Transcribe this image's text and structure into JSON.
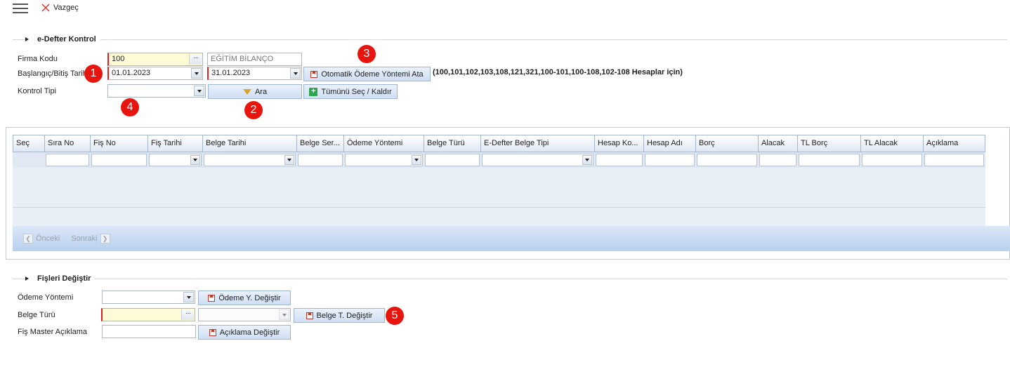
{
  "toolbar": {
    "cancel_label": "Vazgeç"
  },
  "edefter": {
    "title": "e-Defter Kontrol",
    "firma_label": "Firma Kodu",
    "firma_value": "100",
    "firma_name": "EĞİTİM BİLANÇO",
    "tarih_label": "Başlangıç/Bitiş Tarih",
    "start_date": "01.01.2023",
    "end_date": "31.01.2023",
    "auto_btn": "Otomatik Ödeme Yöntemi Ata",
    "auto_note": "(100,101,102,103,108,121,321,100-101,100-108,102-108 Hesaplar için)",
    "kontrol_label": "Kontrol Tipi",
    "kontrol_value": "",
    "ara_btn": "Ara",
    "select_all_btn": "Tümünü Seç / Kaldır"
  },
  "grid": {
    "columns": [
      "Seç",
      "Sıra No",
      "Fiş No",
      "Fiş Tarihi",
      "Belge Tarihi",
      "Belge Ser...",
      "Ödeme Yöntemi",
      "Belge Türü",
      "E-Defter Belge Tipi",
      "Hesap Ko...",
      "Hesap Adı",
      "Borç",
      "Alacak",
      "TL Borç",
      "TL Alacak",
      "Açıklama"
    ],
    "pager_prev": "Önceki",
    "pager_next": "Sonraki"
  },
  "fisler": {
    "title": "Fişleri Değiştir",
    "odeme_label": "Ödeme Yöntemi",
    "odeme_btn": "Ödeme Y. Değiştir",
    "belge_label": "Belge Türü",
    "belge_btn": "Belge T. Değiştir",
    "aciklama_label": "Fiş Master Açıklama",
    "aciklama_btn": "Açıklama Değiştir"
  },
  "badges": [
    "1",
    "2",
    "3",
    "4",
    "5"
  ]
}
